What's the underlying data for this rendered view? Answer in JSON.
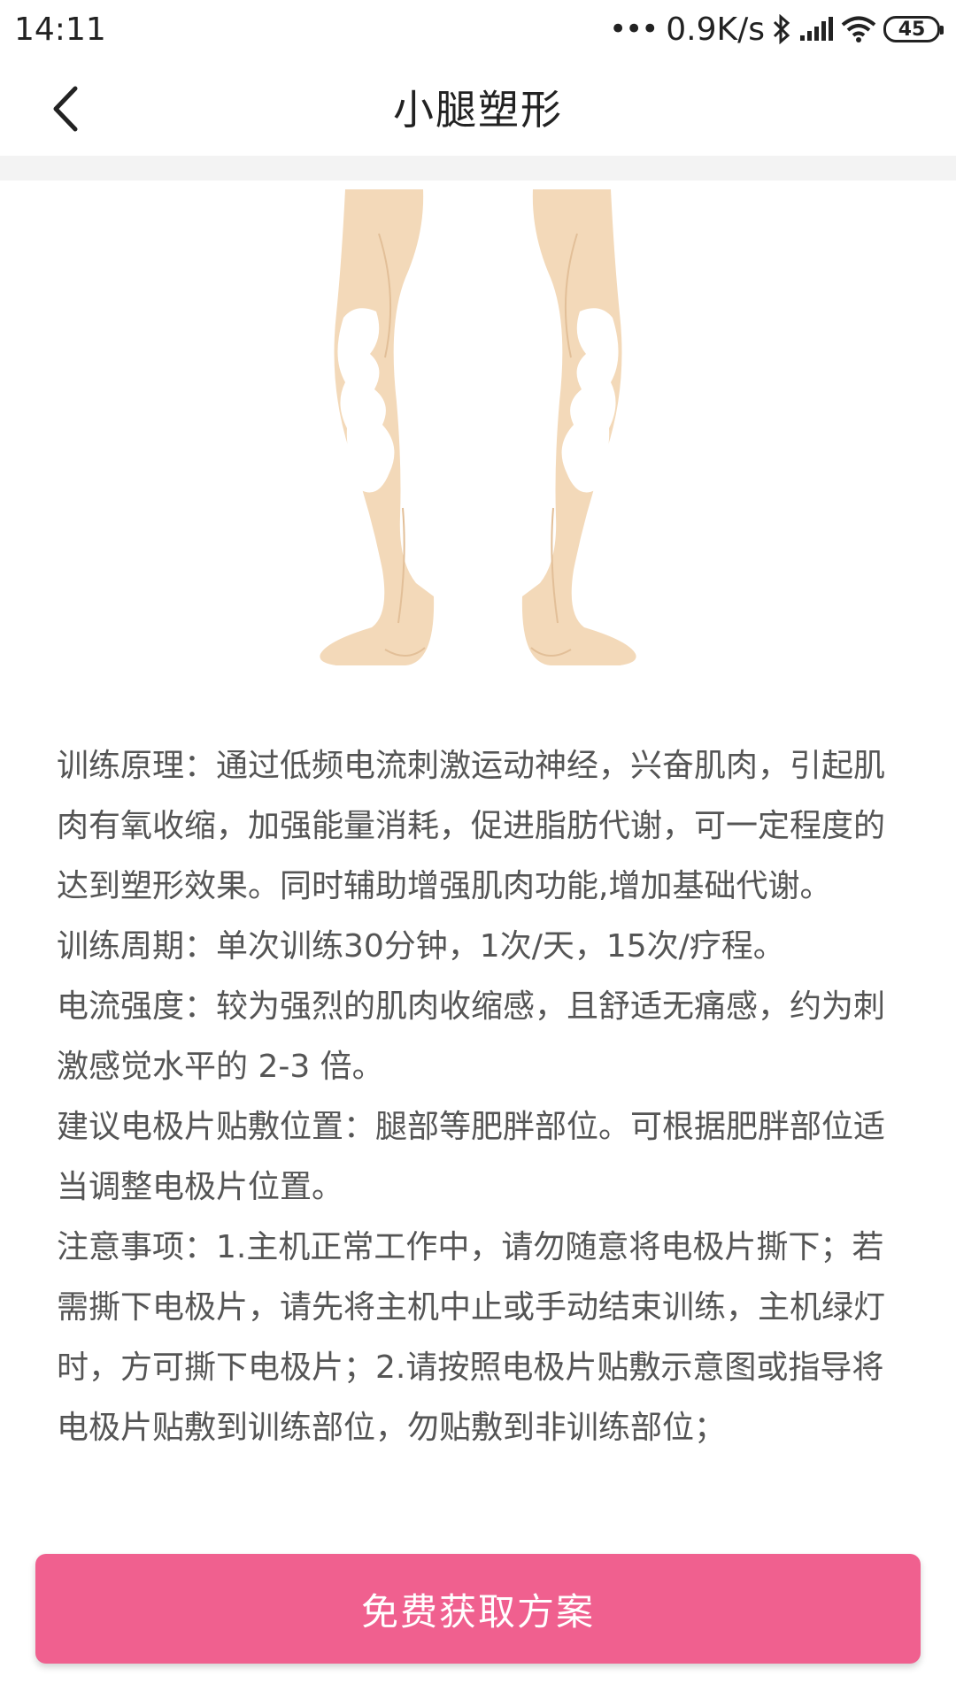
{
  "status_bar": {
    "time": "14:11",
    "network_speed": "0.9K/s",
    "battery": "45"
  },
  "header": {
    "title": "小腿塑形",
    "back_icon": "chevron-left-icon"
  },
  "illustration": {
    "subject": "legs-calf-electrode-placement",
    "skin_color": "#f3d9b9",
    "pad_color": "#ffffff"
  },
  "description": {
    "paragraphs": [
      "训练原理：通过低频电流刺激运动神经，兴奋肌肉，引起肌肉有氧收缩，加强能量消耗，促进脂肪代谢，可一定程度的达到塑形效果。同时辅助增强肌肉功能,增加基础代谢。",
      "训练周期：单次训练30分钟，1次/天，15次/疗程。",
      "电流强度：较为强烈的肌肉收缩感，且舒适无痛感，约为刺激感觉水平的 2-3 倍。",
      "建议电极片贴敷位置：腿部等肥胖部位。可根据肥胖部位适当调整电极片位置。",
      "注意事项：1.主机正常工作中，请勿随意将电极片撕下；若需撕下电极片，请先将主机中止或手动结束训练，主机绿灯时，方可撕下电极片；2.请按照电极片贴敷示意图或指导将电极片贴敷到训练部位，勿贴敷到非训练部位；"
    ]
  },
  "cta": {
    "label": "免费获取方案",
    "color": "#f0608f"
  }
}
